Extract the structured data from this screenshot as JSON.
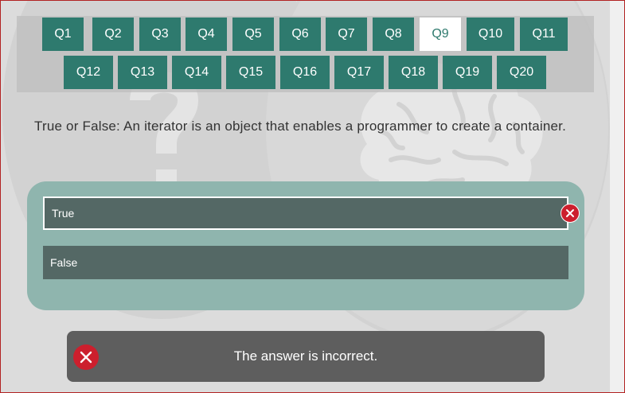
{
  "nav": {
    "row1": [
      "Q1",
      "Q2",
      "Q3",
      "Q4",
      "Q5",
      "Q6",
      "Q7",
      "Q8",
      "Q9",
      "Q10",
      "Q11"
    ],
    "row2": [
      "Q12",
      "Q13",
      "Q14",
      "Q15",
      "Q16",
      "Q17",
      "Q18",
      "Q19",
      "Q20"
    ],
    "active": "Q9"
  },
  "question": {
    "text": "True or False: An iterator is an object that enables a programmer to create a container."
  },
  "options": [
    {
      "label": "True",
      "selected": true,
      "status": "incorrect"
    },
    {
      "label": "False",
      "selected": false
    }
  ],
  "feedback": {
    "text": "The answer is incorrect."
  },
  "colors": {
    "button": "#2e7a6e",
    "panel": "#8fb5ae",
    "option": "#546865",
    "error": "#cc1f2d",
    "feedback": "#5e5e5e"
  },
  "icons": {
    "background_left": "question-mark-icon",
    "background_right": "brain-icon",
    "error": "close-icon"
  }
}
